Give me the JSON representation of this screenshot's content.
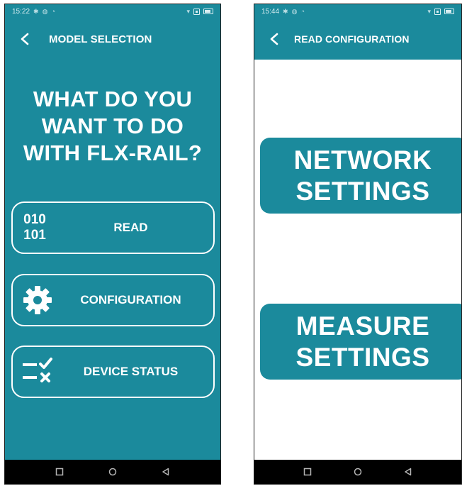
{
  "screens": {
    "model_selection": {
      "status_time": "15:22",
      "title": "MODEL SELECTION",
      "question_lines": [
        "WHAT DO YOU",
        "WANT TO DO",
        "WITH FLX-RAIL?"
      ],
      "buttons": {
        "read": {
          "label": "READ",
          "icon_text": [
            "010",
            "101"
          ],
          "icon": "binary-icon"
        },
        "configuration": {
          "label": "CONFIGURATION",
          "icon": "gear-icon"
        },
        "device_status": {
          "label": "DEVICE STATUS",
          "icon": "checklist-icon"
        }
      }
    },
    "read_configuration": {
      "status_time": "15:44",
      "title": "READ CONFIGURATION",
      "buttons": {
        "network": {
          "lines": [
            "NETWORK",
            "SETTINGS"
          ]
        },
        "measure": {
          "lines": [
            "MEASURE",
            "SETTINGS"
          ]
        }
      }
    }
  },
  "colors": {
    "accent": "#1b8a9c",
    "text_on_accent": "#ffffff",
    "navbar": "#000000"
  },
  "navbar_icons": [
    "recents-square-icon",
    "home-circle-icon",
    "back-triangle-icon"
  ]
}
